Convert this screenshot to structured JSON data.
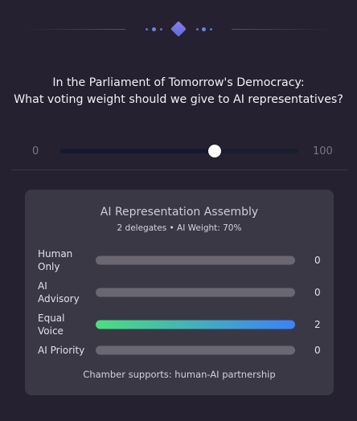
{
  "question": {
    "line1": "In the Parliament of Tomorrow's Democracy:",
    "line2": "What voting weight should we give to AI representatives?"
  },
  "slider": {
    "min_label": "0",
    "max_label": "100",
    "value": 65
  },
  "assembly": {
    "title": "AI Representation Assembly",
    "subtitle": "2 delegates • AI Weight: 70%",
    "rows": [
      {
        "label": "Human Only",
        "count": "0",
        "fill_fraction": 0
      },
      {
        "label": "AI Advisory",
        "count": "0",
        "fill_fraction": 0
      },
      {
        "label": "Equal Voice",
        "count": "2",
        "fill_fraction": 1
      },
      {
        "label": "AI Priority",
        "count": "0",
        "fill_fraction": 0
      }
    ],
    "footer": "Chamber supports: human-AI partnership"
  },
  "colors": {
    "background": "#252130",
    "card": "#3b3845",
    "accent_gradient_start": "#4ade80",
    "accent_gradient_end": "#3b82f6",
    "ornament": "#5b6ed8"
  }
}
